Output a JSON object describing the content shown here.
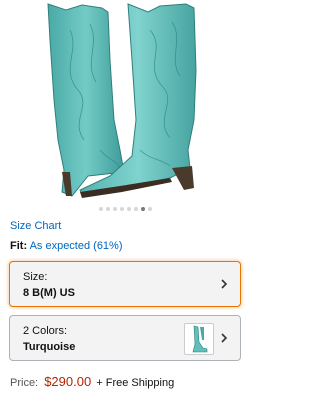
{
  "product": {
    "image_alt": "Turquoise embroidered cowboy boots",
    "image_count": 8,
    "active_image_index": 6
  },
  "links": {
    "size_chart": "Size Chart"
  },
  "fit": {
    "label": "Fit:",
    "value": "As expected (61%)"
  },
  "size_selector": {
    "label": "Size:",
    "value": "8 B(M) US"
  },
  "color_selector": {
    "label": "2 Colors:",
    "value": "Turquoise"
  },
  "price": {
    "label": "Price:",
    "amount": "$290.00",
    "shipping": "+ Free Shipping"
  },
  "colors": {
    "link": "#0066c0",
    "price": "#b12704",
    "focus_border": "#e77600",
    "boot": "#5fbfbb"
  },
  "icons": {
    "chevron": "chevron-right-icon"
  }
}
